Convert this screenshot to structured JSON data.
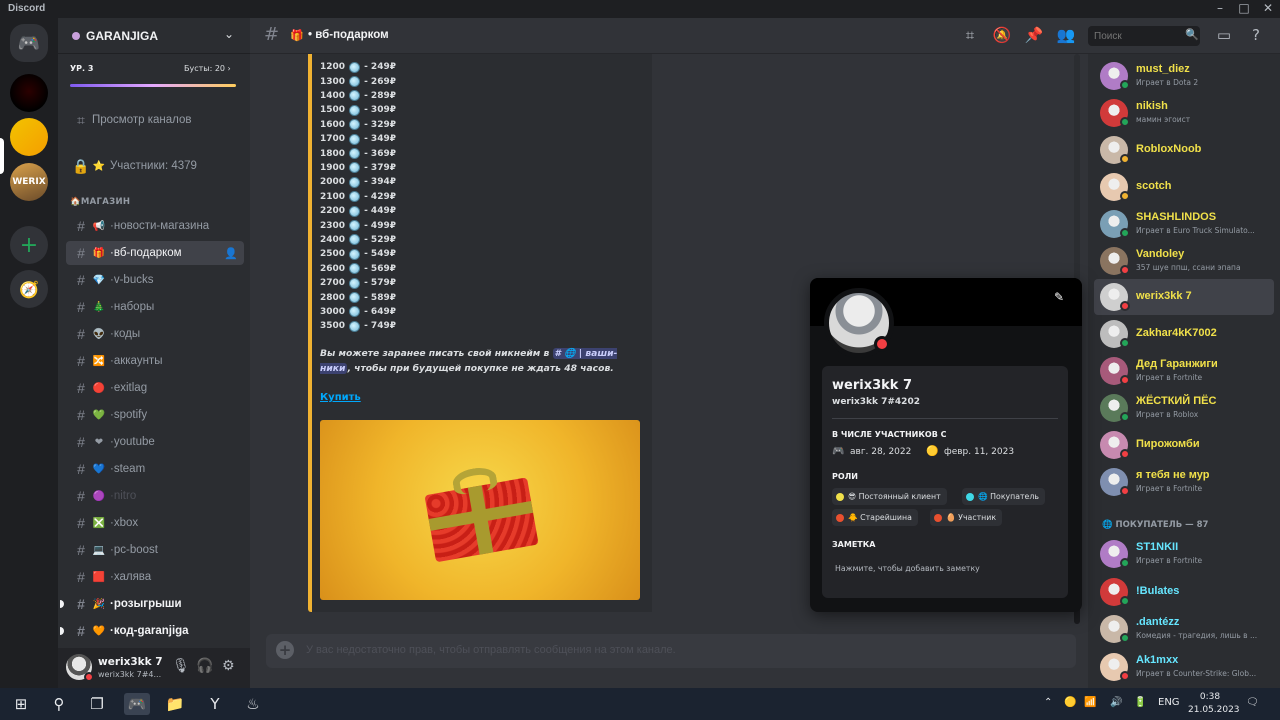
{
  "window": {
    "app_title": "Discord"
  },
  "guild": {
    "name": "GARANJIGA",
    "boost_level": "УР. 3",
    "boosts": "Бусты: 20"
  },
  "sidebar": {
    "browse": "Просмотр каналов",
    "members_count": "Участники: 4379",
    "category": "МАГАЗИН",
    "channels": [
      {
        "emoji": "📢",
        "label": "новости-магазина",
        "state": "normal"
      },
      {
        "emoji": "🎁",
        "label": "вб-подарком",
        "state": "active"
      },
      {
        "emoji": "💎",
        "label": "v-bucks",
        "state": "normal"
      },
      {
        "emoji": "🎄",
        "label": "наборы",
        "state": "normal"
      },
      {
        "emoji": "👽",
        "label": "коды",
        "state": "normal"
      },
      {
        "emoji": "🔀",
        "label": "аккаунты",
        "state": "normal"
      },
      {
        "emoji": "🔴",
        "label": "exitlag",
        "state": "normal"
      },
      {
        "emoji": "💚",
        "label": "spotify",
        "state": "normal"
      },
      {
        "emoji": "❤",
        "label": "youtube",
        "state": "normal"
      },
      {
        "emoji": "💙",
        "label": "steam",
        "state": "normal"
      },
      {
        "emoji": "🟣",
        "label": "nitro",
        "state": "muted"
      },
      {
        "emoji": "❎",
        "label": "xbox",
        "state": "normal"
      },
      {
        "emoji": "💻",
        "label": "pc-boost",
        "state": "normal"
      },
      {
        "emoji": "🟥",
        "label": "халява",
        "state": "normal"
      },
      {
        "emoji": "🎉",
        "label": "розыгрыши",
        "state": "unread"
      },
      {
        "emoji": "🧡",
        "label": "код-garanjiga",
        "state": "unread"
      }
    ]
  },
  "user": {
    "name": "werix3kk 7",
    "tag": "werix3kk 7#4..."
  },
  "header": {
    "channel": "вб-подарком",
    "search_placeholder": "Поиск"
  },
  "embed": {
    "prices": [
      {
        "amount": "1200",
        "price": "- 249₽"
      },
      {
        "amount": "1300",
        "price": "- 269₽"
      },
      {
        "amount": "1400",
        "price": "- 289₽"
      },
      {
        "amount": "1500",
        "price": "- 309₽"
      },
      {
        "amount": "1600",
        "price": "- 329₽"
      },
      {
        "amount": "1700",
        "price": "- 349₽"
      },
      {
        "amount": "1800",
        "price": "- 369₽"
      },
      {
        "amount": "1900",
        "price": "- 379₽"
      },
      {
        "amount": "2000",
        "price": "- 394₽"
      },
      {
        "amount": "2100",
        "price": "- 429₽"
      },
      {
        "amount": "2200",
        "price": "- 449₽"
      },
      {
        "amount": "2300",
        "price": "- 499₽"
      },
      {
        "amount": "2400",
        "price": "- 529₽"
      },
      {
        "amount": "2500",
        "price": "- 549₽"
      },
      {
        "amount": "2600",
        "price": "- 569₽"
      },
      {
        "amount": "2700",
        "price": "- 579₽"
      },
      {
        "amount": "2800",
        "price": "- 589₽"
      },
      {
        "amount": "3000",
        "price": "- 649₽"
      },
      {
        "amount": "3500",
        "price": "- 749₽"
      }
    ],
    "note_before": "Вы можете заранее писать свой никнейм в",
    "note_mention": "# 🌐 | ваши-ники",
    "note_after": ", чтобы при будущей покупке не ждать 48 часов.",
    "link": "Купить"
  },
  "composer": {
    "placeholder": "У вас недостаточно прав, чтобы отправлять сообщения на этом канале."
  },
  "members": {
    "list": [
      {
        "name": "must_diez",
        "activity": "Играет в Dota 2",
        "status": "online",
        "color": "yellow"
      },
      {
        "name": "nikish",
        "activity": "мамин эгоист",
        "status": "online",
        "color": "yellow"
      },
      {
        "name": "RobloxNoob",
        "activity": "",
        "status": "idle",
        "color": "yellow"
      },
      {
        "name": "scotch",
        "activity": "",
        "status": "idle",
        "color": "yellow"
      },
      {
        "name": "SHASHLINDOS",
        "activity": "Играет в Euro Truck Simulato...",
        "status": "online",
        "color": "yellow"
      },
      {
        "name": "Vandoley",
        "activity": "357 шуе ппш, ссани эпапа",
        "status": "dnd",
        "color": "yellow"
      },
      {
        "name": "werix3kk 7",
        "activity": "",
        "status": "dnd",
        "color": "yellow"
      },
      {
        "name": "Zakhar4kK7002",
        "activity": "",
        "status": "online",
        "color": "yellow"
      },
      {
        "name": "Дед Гаранжиги",
        "activity": "Играет в Fortnite",
        "status": "dnd",
        "color": "yellow"
      },
      {
        "name": "ЖЁСТКИЙ ПЁС",
        "activity": "Играет в Roblox",
        "status": "online",
        "color": "yellow"
      },
      {
        "name": "Пирожомби",
        "activity": "",
        "status": "dnd",
        "color": "yellow"
      },
      {
        "name": "я тебя не мур",
        "activity": "Играет в Fortnite",
        "status": "dnd",
        "color": "yellow"
      }
    ],
    "category": "ПОКУПАТЕЛЬ — 87",
    "list2": [
      {
        "name": "ST1NKII",
        "activity": "Играет в Fortnite",
        "status": "online",
        "color": "teal"
      },
      {
        "name": "!Bulates",
        "activity": "",
        "status": "online",
        "color": "teal"
      },
      {
        "name": ".dantézz",
        "activity": "Комедия - трагедия, лишь в ...",
        "status": "online",
        "color": "teal"
      },
      {
        "name": "Ak1mxx",
        "activity": "Играет в Counter-Strike: Glob...",
        "status": "dnd",
        "color": "teal"
      }
    ]
  },
  "profile": {
    "name": "werix3kk 7",
    "tag": "werix3kk 7#4202",
    "member_since_label": "В ЧИСЛЕ УЧАСТНИКОВ С",
    "discord_date": "авг. 28, 2022",
    "server_date": "февр. 11, 2023",
    "roles_label": "РОЛИ",
    "roles": [
      {
        "label": "😎 Постоянный клиент",
        "color": "#f0e04a"
      },
      {
        "label": "🌐 Покупатель",
        "color": "#3fd8e6"
      },
      {
        "label": "🐥 Старейшина",
        "color": "#e8502f"
      },
      {
        "label": "🥚 Участник",
        "color": "#e8502f"
      }
    ],
    "note_label": "ЗАМЕТКА",
    "note_placeholder": "Нажмите, чтобы добавить заметку"
  },
  "taskbar": {
    "lang": "ENG",
    "time": "0:38",
    "date": "21.05.2023"
  },
  "colors": {
    "online": "#23a559",
    "idle": "#f0b232",
    "dnd": "#f23f43",
    "accent": "#5865f2"
  }
}
